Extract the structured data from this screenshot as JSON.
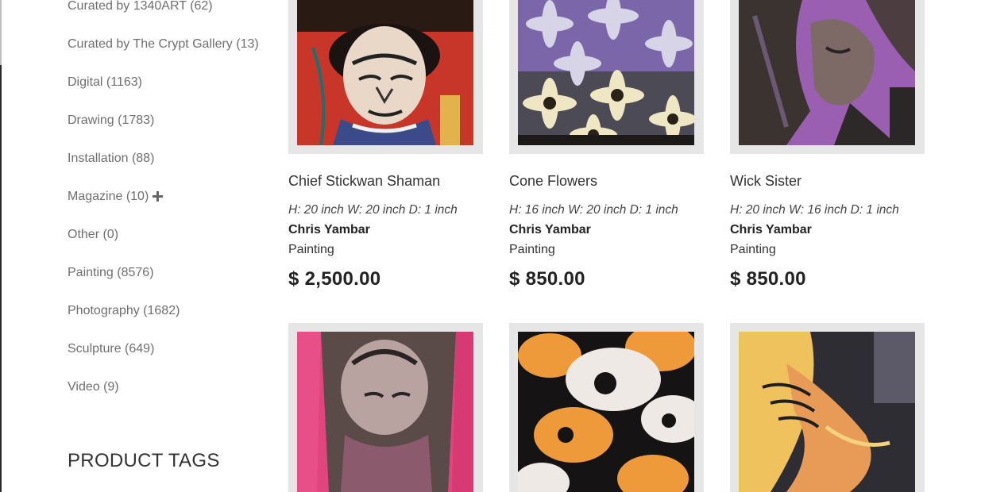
{
  "sidebar": {
    "categories": [
      {
        "label": "Curated by 1340ART (62)"
      },
      {
        "label": "Curated by The Crypt Gallery (13)"
      },
      {
        "label": "Digital (1163)"
      },
      {
        "label": "Drawing (1783)"
      },
      {
        "label": "Installation (88)"
      },
      {
        "label": "Magazine (10)",
        "expand_icon": "plus-icon"
      },
      {
        "label": "Other (0)"
      },
      {
        "label": "Painting (8576)"
      },
      {
        "label": "Photography (1682)"
      },
      {
        "label": "Sculpture (649)"
      },
      {
        "label": "Video (9)"
      }
    ],
    "tags_heading": "PRODUCT TAGS"
  },
  "products": [
    {
      "title": "Chief Stickwan Shaman",
      "dims": "H: 20 inch W: 20 inch D: 1 inch",
      "artist": "Chris Yambar",
      "medium": "Painting",
      "price": "$ 2,500.00"
    },
    {
      "title": "Cone Flowers",
      "dims": "H: 16 inch W: 20 inch D: 1 inch",
      "artist": "Chris Yambar",
      "medium": "Painting",
      "price": "$ 850.00"
    },
    {
      "title": "Wick Sister",
      "dims": "H: 20 inch W: 16 inch D: 1 inch",
      "artist": "Chris Yambar",
      "medium": "Painting",
      "price": "$ 850.00"
    },
    {
      "title": "",
      "dims": "",
      "artist": "",
      "medium": "",
      "price": ""
    },
    {
      "title": "",
      "dims": "",
      "artist": "",
      "medium": "",
      "price": ""
    },
    {
      "title": "",
      "dims": "",
      "artist": "",
      "medium": "",
      "price": ""
    }
  ],
  "colors": {
    "sidebar_text": "#6f6f6f",
    "frame": "#e6e6e6",
    "price": "#222222"
  }
}
